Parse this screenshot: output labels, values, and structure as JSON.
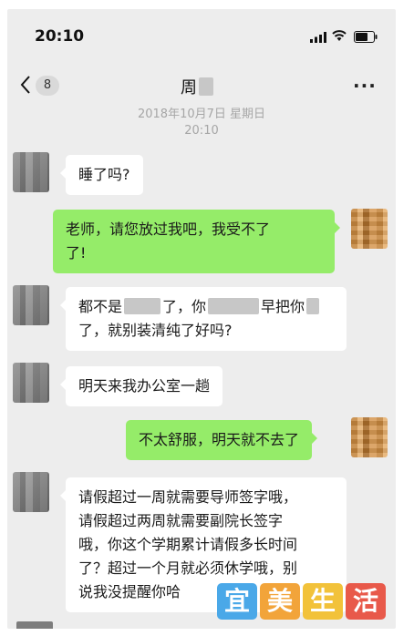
{
  "status_bar": {
    "time": "20:10"
  },
  "nav": {
    "unread_count": "8",
    "title": "周",
    "more": "···"
  },
  "chat": {
    "timestamp_line1": "2018年10月7日 星期日",
    "timestamp_line2": "20:10",
    "messages": [
      {
        "side": "in",
        "lines": [
          "睡了吗?"
        ]
      },
      {
        "side": "out",
        "lines": [
          "老师，请您放过我吧，我受不了",
          "了!"
        ]
      },
      {
        "side": "in",
        "segments": [
          "都不是",
          "了，你",
          "早把你",
          "了，就别装清纯了好吗?"
        ]
      },
      {
        "side": "in",
        "lines": [
          "明天来我办公室一趟"
        ]
      },
      {
        "side": "out",
        "lines": [
          "不太舒服，明天就不去了"
        ]
      },
      {
        "side": "in",
        "lines": [
          "请假超过一周就需要导师签字哦，",
          "请假超过两周就需要副院长签字",
          "哦，你这个学期累计请假多长时间",
          "了？超过一个月就必须休学哦，别",
          "说我没提醒你哈"
        ]
      }
    ]
  },
  "watermark": [
    "宜",
    "美",
    "生",
    "活"
  ],
  "colors": {
    "background": "#ededed",
    "incoming": "#ffffff",
    "outgoing": "#95ec69"
  },
  "icons": [
    "signal-icon",
    "wifi-icon",
    "battery-icon",
    "back-icon",
    "more-icon"
  ]
}
